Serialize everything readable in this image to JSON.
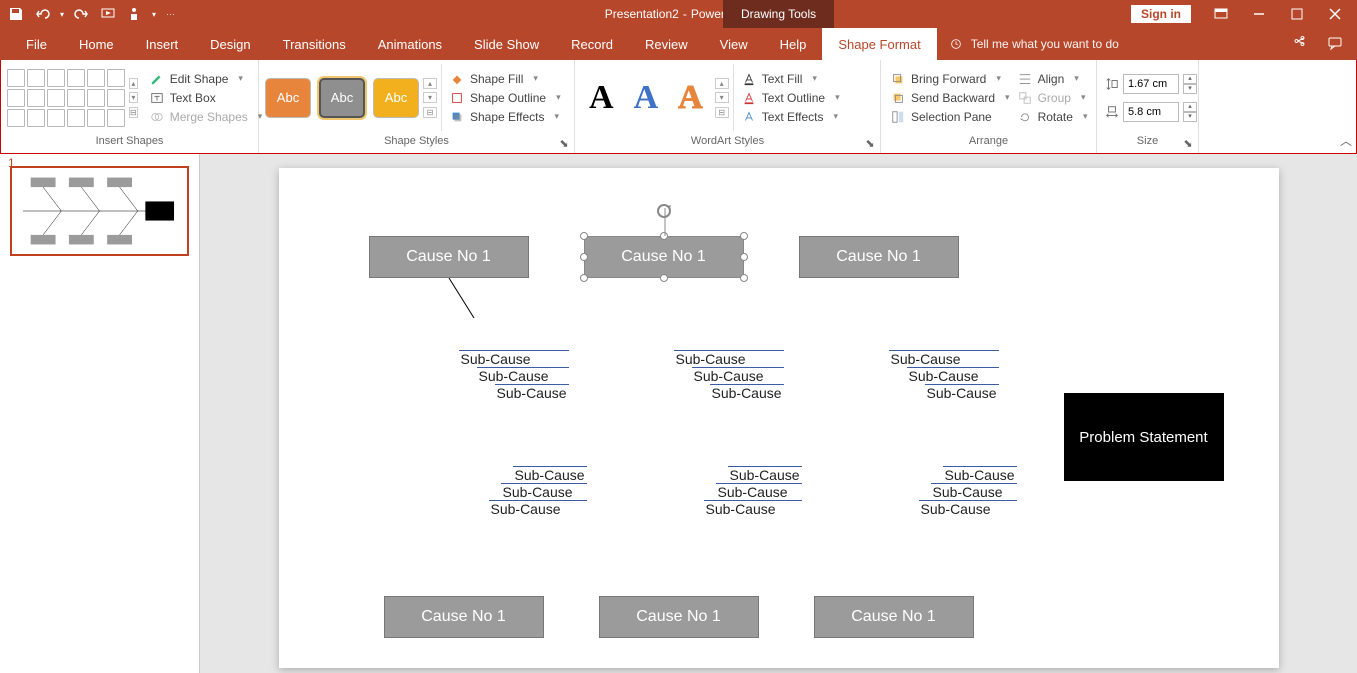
{
  "titlebar": {
    "doc_title": "Presentation2",
    "app_name": "PowerPoint",
    "contextual": "Drawing Tools",
    "sign_in": "Sign in"
  },
  "tabs": {
    "file": "File",
    "home": "Home",
    "insert": "Insert",
    "design": "Design",
    "transitions": "Transitions",
    "animations": "Animations",
    "slideshow": "Slide Show",
    "record": "Record",
    "review": "Review",
    "view": "View",
    "help": "Help",
    "shape_format": "Shape Format",
    "tell_me": "Tell me what you want to do"
  },
  "ribbon": {
    "insert_shapes": {
      "label": "Insert Shapes",
      "edit_shape": "Edit Shape",
      "text_box": "Text Box",
      "merge_shapes": "Merge Shapes"
    },
    "shape_styles": {
      "label": "Shape Styles",
      "swatch": "Abc",
      "fill": "Shape Fill",
      "outline": "Shape Outline",
      "effects": "Shape Effects"
    },
    "wordart": {
      "label": "WordArt Styles",
      "sample": "A",
      "text_fill": "Text Fill",
      "text_outline": "Text Outline",
      "text_effects": "Text Effects"
    },
    "arrange": {
      "label": "Arrange",
      "bring_forward": "Bring Forward",
      "send_backward": "Send Backward",
      "selection_pane": "Selection Pane",
      "align": "Align",
      "group": "Group",
      "rotate": "Rotate"
    },
    "size": {
      "label": "Size",
      "height": "1.67 cm",
      "width": "5.8 cm"
    }
  },
  "slidepanel": {
    "num": "1"
  },
  "diagram": {
    "cause_label": "Cause No 1",
    "sub": "Sub-Cause",
    "problem": "Problem Statement"
  }
}
